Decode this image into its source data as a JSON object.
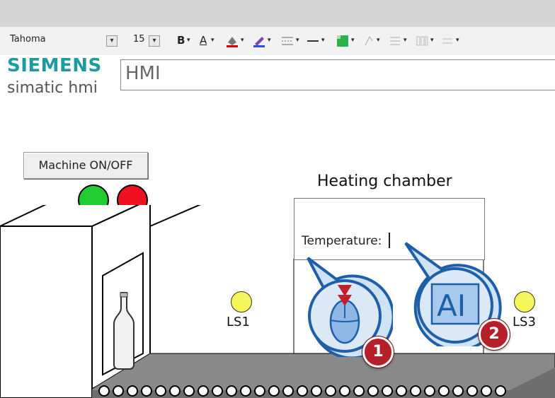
{
  "toolbar": {
    "font_name": "Tahoma",
    "font_size": "15",
    "bold_label": "B",
    "text_color_label": "A",
    "dropdown_arrow": "▾"
  },
  "logo": {
    "brand": "SIEMENS",
    "product": "simatic hmi"
  },
  "title_field": {
    "value": "HMI"
  },
  "machine_button": {
    "label": "Machine ON/OFF"
  },
  "lamps": {
    "on_color": "#22cc33",
    "off_color": "#ee1122"
  },
  "heating_chamber": {
    "title": "Heating chamber",
    "temperature_label": "Temperature:"
  },
  "sensors": [
    {
      "label": "LS1",
      "color": "#f6f65a"
    },
    {
      "label": "LS3",
      "color": "#f6f65a"
    }
  ],
  "callouts": [
    {
      "number": "1",
      "icon": "mouse-click-icon"
    },
    {
      "number": "2",
      "icon": "text-edit-icon",
      "icon_text": "AI"
    }
  ],
  "colors": {
    "brand_teal": "#1d9aa2",
    "callout_blue": "#2b6cb0",
    "badge_red": "#b5202a"
  }
}
